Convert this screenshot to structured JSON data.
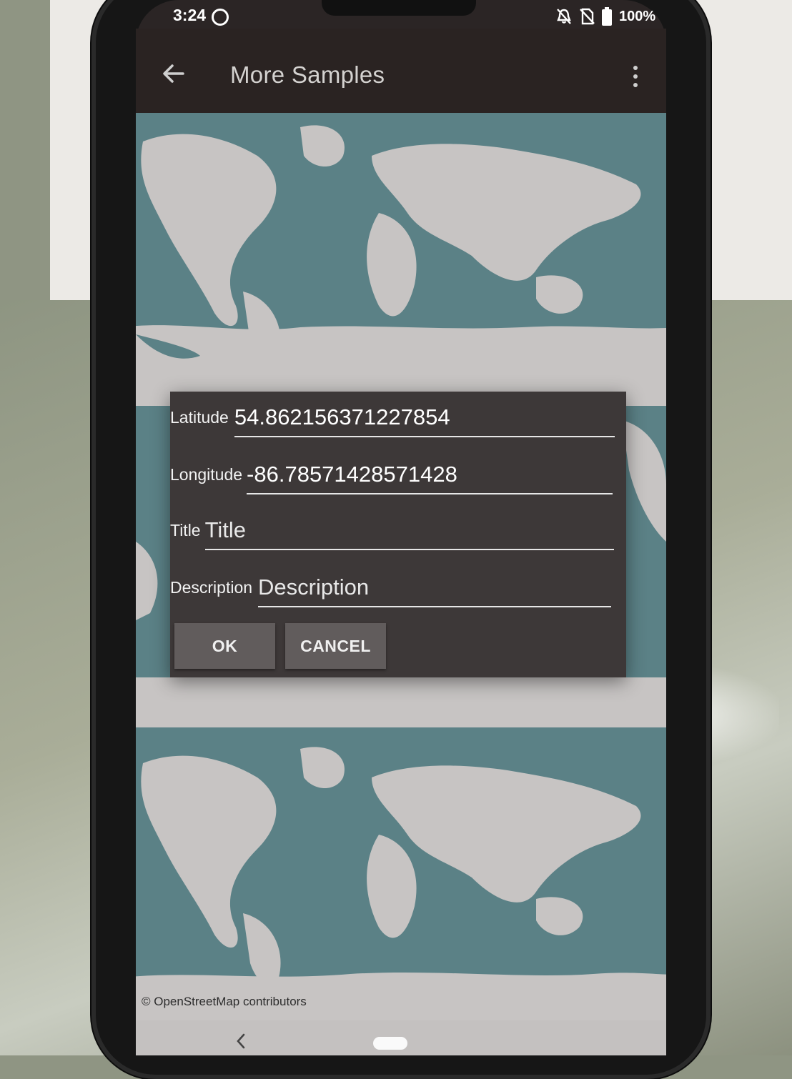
{
  "status_bar": {
    "time": "3:24",
    "battery": "100%"
  },
  "app_bar": {
    "title": "More Samples"
  },
  "map": {
    "attribution": "© OpenStreetMap contributors",
    "ocean_color": "#5b8186",
    "land_color": "#c7c4c3"
  },
  "dialog": {
    "fields": [
      {
        "label": "Latitude",
        "value": "54.862156371227854",
        "placeholder": ""
      },
      {
        "label": "Longitude",
        "value": "-86.78571428571428",
        "placeholder": ""
      },
      {
        "label": "Title",
        "value": "",
        "placeholder": "Title"
      },
      {
        "label": "Description",
        "value": "",
        "placeholder": "Description"
      }
    ],
    "ok_label": "OK",
    "cancel_label": "CANCEL"
  }
}
